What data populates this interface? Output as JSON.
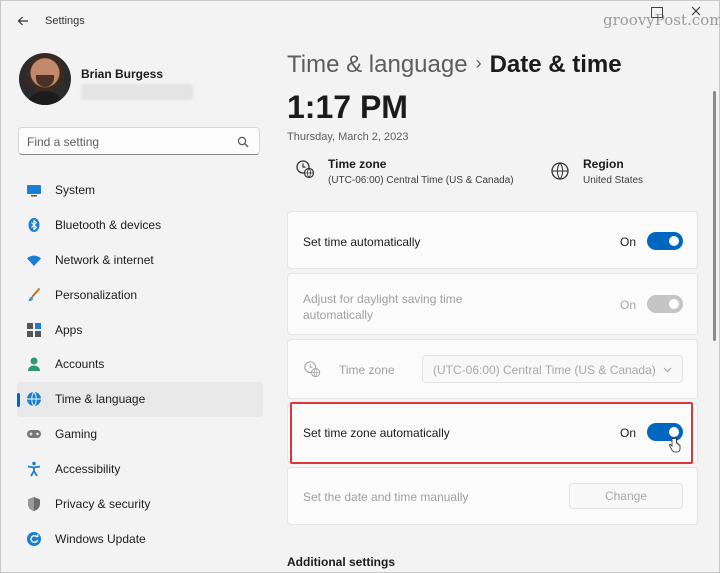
{
  "window": {
    "title": "Settings",
    "watermark": "groovyPost.com"
  },
  "profile": {
    "name": "Brian Burgess"
  },
  "search": {
    "placeholder": "Find a setting"
  },
  "sidebar": {
    "items": [
      {
        "label": "System",
        "icon": "system-icon",
        "active": false
      },
      {
        "label": "Bluetooth & devices",
        "icon": "bluetooth-icon",
        "active": false
      },
      {
        "label": "Network & internet",
        "icon": "wifi-icon",
        "active": false
      },
      {
        "label": "Personalization",
        "icon": "brush-icon",
        "active": false
      },
      {
        "label": "Apps",
        "icon": "apps-icon",
        "active": false
      },
      {
        "label": "Accounts",
        "icon": "accounts-icon",
        "active": false
      },
      {
        "label": "Time & language",
        "icon": "time-language-icon",
        "active": true
      },
      {
        "label": "Gaming",
        "icon": "gamepad-icon",
        "active": false
      },
      {
        "label": "Accessibility",
        "icon": "accessibility-icon",
        "active": false
      },
      {
        "label": "Privacy & security",
        "icon": "shield-icon",
        "active": false
      },
      {
        "label": "Windows Update",
        "icon": "update-icon",
        "active": false
      }
    ]
  },
  "header": {
    "parent": "Time & language",
    "separator": "›",
    "current": "Date & time",
    "clock": "1:17 PM",
    "date": "Thursday, March 2, 2023"
  },
  "info": {
    "timezone_title": "Time zone",
    "timezone_value": "(UTC-06:00) Central Time (US & Canada)",
    "region_title": "Region",
    "region_value": "United States"
  },
  "settings": {
    "set_time_auto": {
      "label": "Set time automatically",
      "state": "On"
    },
    "daylight_saving": {
      "label": "Adjust for daylight saving time automatically",
      "state": "On"
    },
    "time_zone": {
      "label": "Time zone",
      "value": "(UTC-06:00) Central Time (US & Canada)"
    },
    "set_tz_auto": {
      "label": "Set time zone automatically",
      "state": "On"
    },
    "manual": {
      "label": "Set the date and time manually",
      "button": "Change"
    }
  },
  "additional": {
    "heading": "Additional settings"
  },
  "colors": {
    "accent": "#0067c0",
    "highlight": "#d9383a"
  }
}
